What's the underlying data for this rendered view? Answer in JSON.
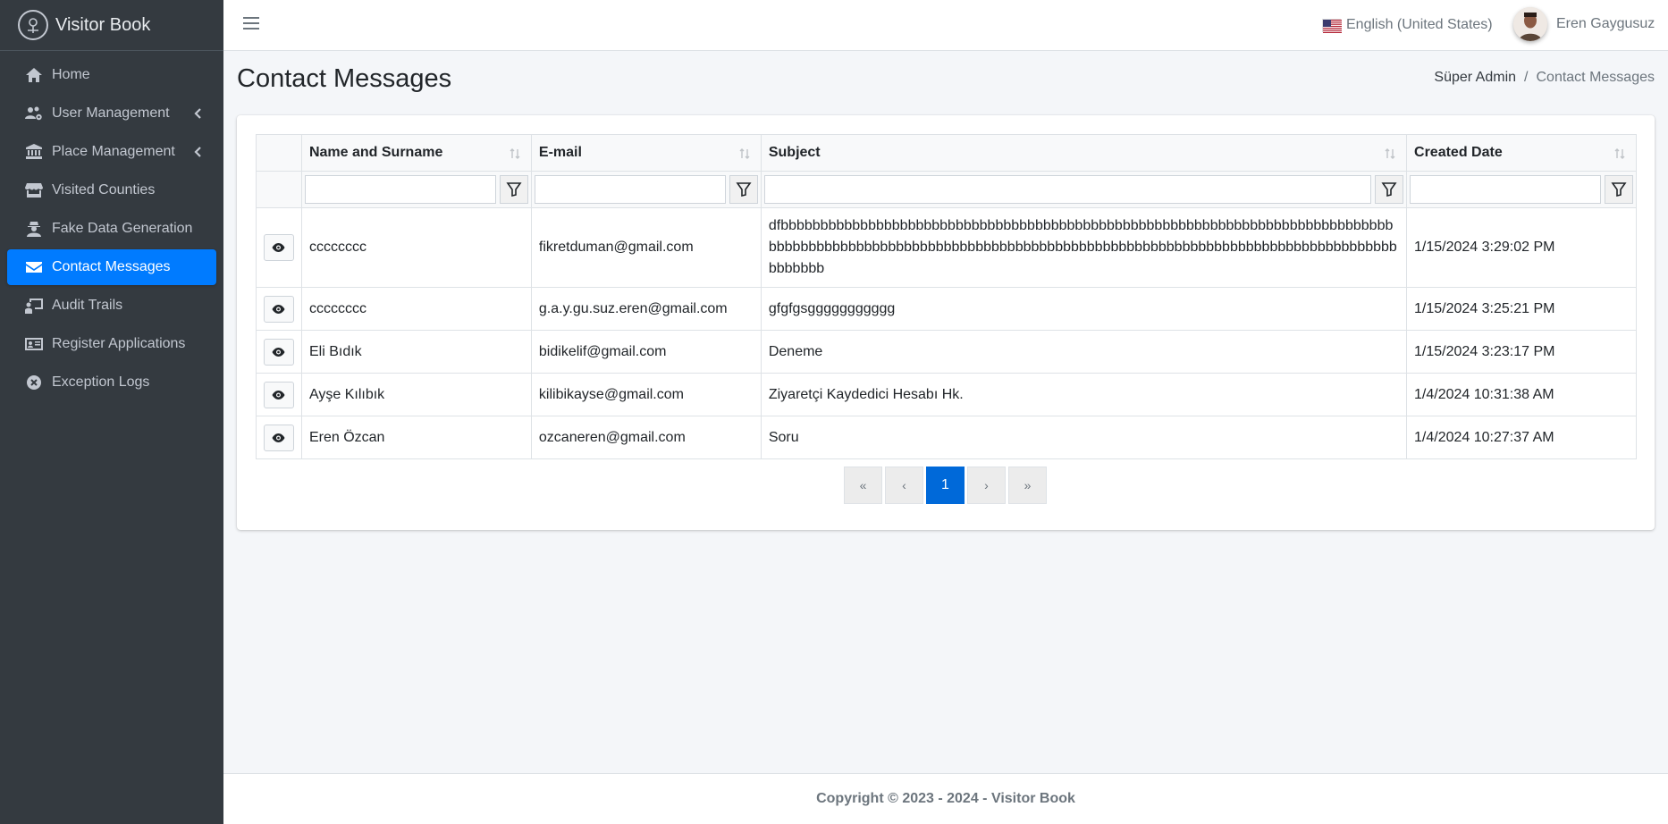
{
  "brand": {
    "name": "Visitor Book"
  },
  "sidebar": {
    "items": [
      {
        "label": "Home",
        "icon": "home-icon"
      },
      {
        "label": "User Management",
        "icon": "users-cog-icon",
        "has_caret": true
      },
      {
        "label": "Place Management",
        "icon": "landmark-icon",
        "has_caret": true
      },
      {
        "label": "Visited Counties",
        "icon": "store-icon"
      },
      {
        "label": "Fake Data Generation",
        "icon": "user-secret-icon"
      },
      {
        "label": "Contact Messages",
        "icon": "envelope-icon",
        "active": true
      },
      {
        "label": "Audit Trails",
        "icon": "chalkboard-teacher-icon"
      },
      {
        "label": "Register Applications",
        "icon": "id-card-icon"
      },
      {
        "label": "Exception Logs",
        "icon": "times-circle-icon"
      }
    ]
  },
  "topbar": {
    "language": "English (United States)",
    "user_name": "Eren Gaygusuz"
  },
  "page": {
    "title": "Contact Messages",
    "breadcrumb": {
      "root": "Süper Admin",
      "separator": "/",
      "current": "Contact Messages"
    }
  },
  "table": {
    "columns": [
      "Name and Surname",
      "E-mail",
      "Subject",
      "Created Date"
    ],
    "rows": [
      {
        "name": "cccccccc",
        "email": "fikretduman@gmail.com",
        "subject": "dfbbbbbbbbbbbbbbbbbbbbbbbbbbbbbbbbbbbbbbbbbbbbbbbbbbbbbbbbbbbbbbbbbbbbbbbbbbbbbbbbbbbbbbbbbbbbbbbbbbbbbbbbbbbbbbbbbbbbbbbbbbbbbbbbbbbbbbbbbbbbbbbbbbbbbbbbbbbbbbbbbbb",
        "date": "1/15/2024 3:29:02 PM"
      },
      {
        "name": "cccccccc",
        "email": "g.a.y.gu.suz.eren@gmail.com",
        "subject": "gfgfgsggggggggggg",
        "date": "1/15/2024 3:25:21 PM"
      },
      {
        "name": "Eli Bıdık",
        "email": "bidikelif@gmail.com",
        "subject": "Deneme",
        "date": "1/15/2024 3:23:17 PM"
      },
      {
        "name": "Ayşe Kılıbık",
        "email": "kilibikayse@gmail.com",
        "subject": "Ziyaretçi Kaydedici Hesabı Hk.",
        "date": "1/4/2024 10:31:38 AM"
      },
      {
        "name": "Eren Özcan",
        "email": "ozcaneren@gmail.com",
        "subject": "Soru",
        "date": "1/4/2024 10:27:37 AM"
      }
    ]
  },
  "pagination": {
    "first": "«",
    "prev": "‹",
    "current": "1",
    "next": "›",
    "last": "»"
  },
  "footer": {
    "text": "Copyright © 2023 - 2024 - Visitor Book"
  },
  "colors": {
    "sidebar_bg": "#343a40",
    "active": "#007bff",
    "page_bg": "#f4f6f9"
  }
}
